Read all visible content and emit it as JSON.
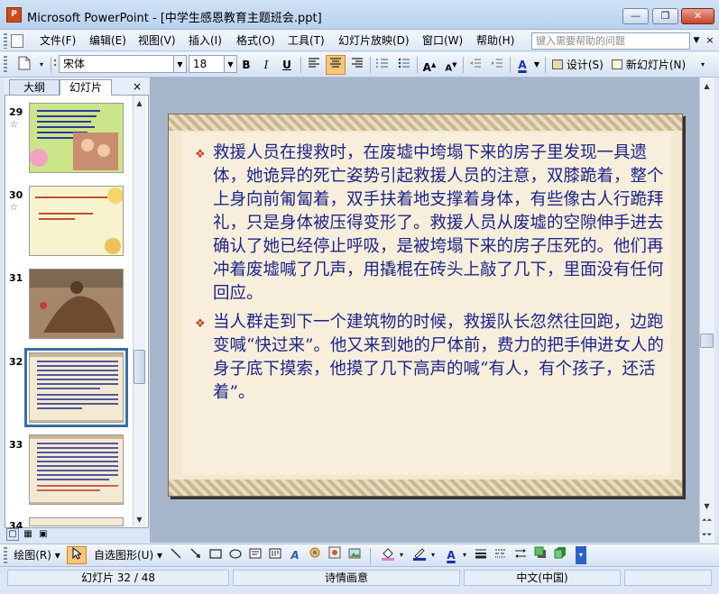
{
  "window": {
    "title": "Microsoft PowerPoint - [中学生感恩教育主题班会.ppt]",
    "app_icon_label": "P",
    "controls": {
      "minimize": "—",
      "restore": "❐",
      "close": "✕"
    }
  },
  "menubar": {
    "items": [
      "文件(F)",
      "编辑(E)",
      "视图(V)",
      "插入(I)",
      "格式(O)",
      "工具(T)",
      "幻灯片放映(D)",
      "窗口(W)",
      "帮助(H)"
    ],
    "help_placeholder": "键入需要帮助的问题",
    "doc_close": "×"
  },
  "toolbar": {
    "font_name": "宋体",
    "font_size": "18",
    "bold": "B",
    "italic": "I",
    "underline": "U",
    "design_label": "设计(S)",
    "new_slide_label": "新幻灯片(N)",
    "font_color_glyph": "A"
  },
  "left_panel": {
    "tabs": [
      "大纲",
      "幻灯片"
    ],
    "active_tab": "幻灯片",
    "close_glyph": "×",
    "thumbnails": [
      {
        "number": "29",
        "has_animation": true,
        "selected": false
      },
      {
        "number": "30",
        "has_animation": true,
        "selected": false
      },
      {
        "number": "31",
        "has_animation": false,
        "selected": false
      },
      {
        "number": "32",
        "has_animation": false,
        "selected": true
      },
      {
        "number": "33",
        "has_animation": false,
        "selected": false
      },
      {
        "number": "34",
        "has_animation": false,
        "selected": false
      }
    ]
  },
  "slide": {
    "bullets": [
      "救援人员在搜救时，在废墟中垮塌下来的房子里发现一具遗体，她诡异的死亡姿势引起救援人员的注意，双膝跪着，整个上身向前匍匐着，双手扶着地支撑着身体，有些像古人行跪拜礼，只是身体被压得变形了。救援人员从废墟的空隙伸手进去确认了她已经停止呼吸，是被垮塌下来的房子压死的。他们再冲着废墟喊了几声，用撬棍在砖头上敲了几下，里面没有任何回应。",
      "当人群走到下一个建筑物的时候，救援队长忽然往回跑，边跑变喊“快过来”。他又来到她的尸体前，费力的把手伸进女人的身子底下摸索，他摸了几下高声的喊“有人，有个孩子，还活着”。"
    ]
  },
  "drawbar": {
    "draw_label": "绘图(R)",
    "autoshape_label": "自选图形(U)"
  },
  "statusbar": {
    "slide_position": "幻灯片 32 / 48",
    "design_name": "诗情画意",
    "language": "中文(中国)"
  },
  "colors": {
    "slide_text": "#1d2489",
    "bullet": "#c0482a",
    "selection": "#3a6ea5"
  }
}
